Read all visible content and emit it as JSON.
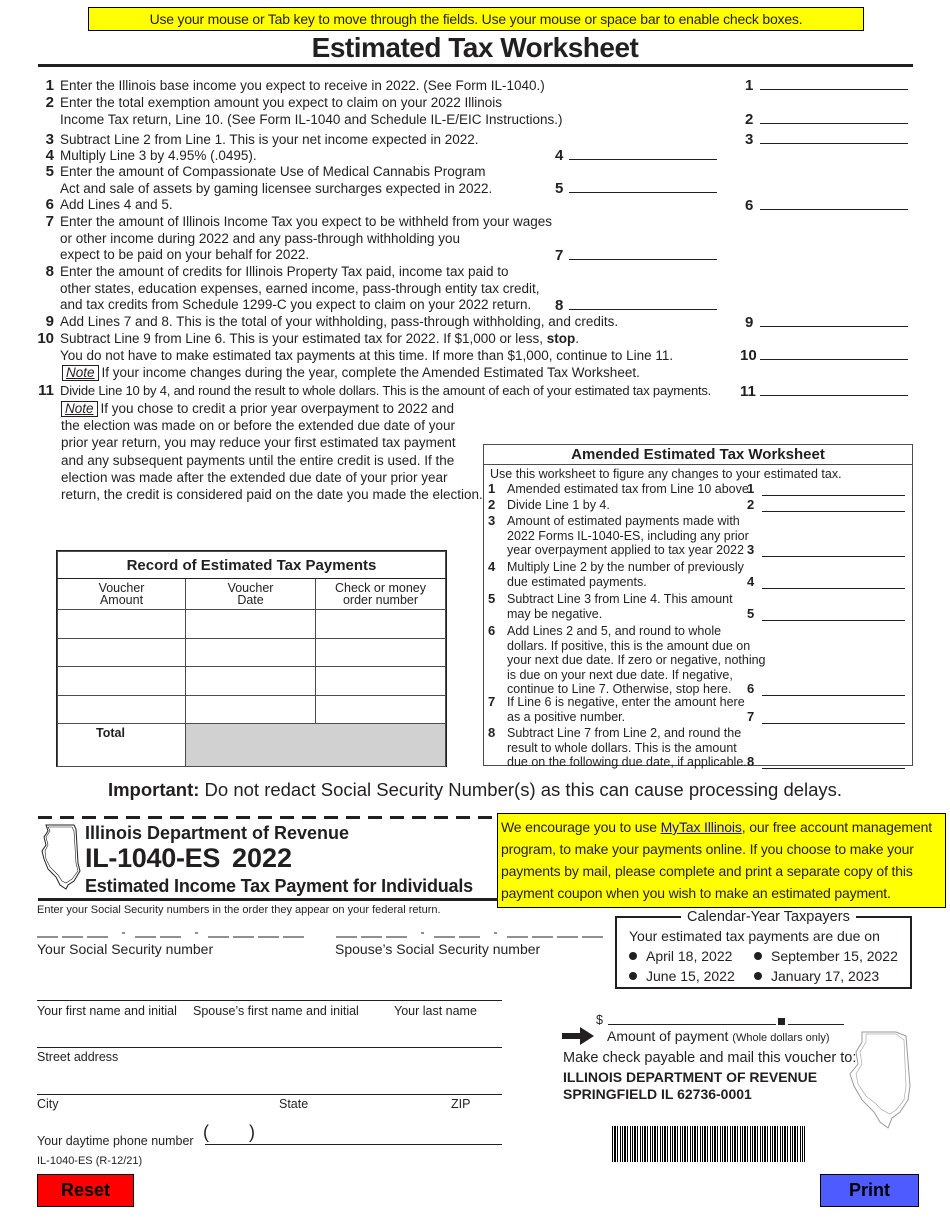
{
  "banner": "Use your mouse or Tab key to move through the fields. Use your mouse or space bar to enable check boxes.",
  "worksheet": {
    "title": "Estimated Tax Worksheet",
    "lines": [
      {
        "num": "1",
        "text": [
          "Enter the Illinois base income you expect to receive in 2022. (See Form IL-1040.)"
        ],
        "field_label": "1"
      },
      {
        "num": "2",
        "text": [
          "Enter the total exemption amount you expect to claim on your 2022 Illinois",
          "Income Tax return, Line 10.  (See Form IL-1040 and Schedule IL-E/EIC Instructions.)"
        ],
        "field_label": "2"
      },
      {
        "num": "3",
        "text": [
          "Subtract Line 2 from Line 1. This is your net income expected in 2022."
        ],
        "field_label": "3"
      },
      {
        "num": "4",
        "text": [
          "Multiply Line 3 by 4.95% (.0495)."
        ],
        "field_label": "4"
      },
      {
        "num": "5",
        "text": [
          "Enter the amount of Compassionate Use of Medical Cannabis Program",
          "Act and sale of assets by gaming licensee surcharges expected in 2022."
        ],
        "field_label": "5"
      },
      {
        "num": "6",
        "text": [
          "Add Lines 4 and 5."
        ],
        "field_label": "6"
      },
      {
        "num": "7",
        "text": [
          "Enter the amount of Illinois Income Tax you expect to be withheld from your wages",
          "or other income during 2022 and any pass-through withholding you",
          "expect to be paid on your behalf for 2022."
        ],
        "field_label": "7"
      },
      {
        "num": "8",
        "text": [
          "Enter the amount of credits for Illinois Property Tax paid, income tax paid to",
          "other states, education expenses, earned income, pass-through entity tax credit,",
          "and tax credits from Schedule 1299-C you expect to claim on your 2022 return."
        ],
        "field_label": "8"
      },
      {
        "num": "9",
        "text": [
          "Add Lines 7 and 8. This is the total of your withholding, pass-through withholding, and credits."
        ],
        "field_label": "9"
      },
      {
        "num": "10",
        "text": [
          "Subtract Line 9 from Line 6. This is your estimated tax for 2022. If $1,000 or less, ",
          "You do not have to make estimated tax payments at this time. If more than $1,000, continue to Line 11."
        ],
        "stop_word": "stop",
        "field_label": "10"
      },
      {
        "num": "11",
        "text": [
          "Divide Line 10 by 4, and round the result to whole dollars. This is the amount of each of your estimated tax payments."
        ],
        "field_label": "11"
      }
    ],
    "note_label": "Note",
    "note10": "If your income changes during the year, complete the Amended Estimated Tax Worksheet.",
    "note11": [
      "If you chose to credit a prior year overpayment to 2022 and",
      "the election was made on or before the extended due date of your",
      "prior year return, you may reduce your first estimated tax payment",
      "and any subsequent payments until the entire credit is used. If the",
      "election was made after the extended due date of your prior year",
      "return, the credit is considered paid on the date you made the election."
    ]
  },
  "amended": {
    "title": "Amended Estimated Tax Worksheet",
    "intro": "Use this worksheet to figure any changes to your estimated tax.",
    "lines": [
      {
        "num": "1",
        "text": [
          "Amended estimated tax from Line 10 above"
        ]
      },
      {
        "num": "2",
        "text": [
          "Divide Line 1 by 4."
        ]
      },
      {
        "num": "3",
        "text": [
          "Amount of estimated payments made with",
          "2022 Forms IL-1040-ES, including any prior",
          "year overpayment applied to tax year 2022"
        ]
      },
      {
        "num": "4",
        "text": [
          "Multiply Line 2 by the number of previously",
          "due estimated payments."
        ]
      },
      {
        "num": "5",
        "text": [
          "Subtract Line 3 from Line 4. This amount",
          "may be negative."
        ]
      },
      {
        "num": "6",
        "text": [
          "Add Lines 2 and 5, and round to whole",
          "dollars. If positive, this is the amount due on",
          "your next due date. If zero or negative, nothing",
          "is due on your next due date. If negative,",
          "continue to Line 7. Otherwise, stop here."
        ]
      },
      {
        "num": "7",
        "text": [
          "If Line 6 is negative, enter the amount here",
          "as a positive number."
        ]
      },
      {
        "num": "8",
        "text": [
          "Subtract Line 7 from Line 2, and round the",
          "result to whole dollars. This is the amount",
          "due on the following due date, if applicable."
        ]
      }
    ]
  },
  "record": {
    "title": "Record of Estimated Tax Payments",
    "columns": [
      [
        "Voucher",
        "Amount"
      ],
      [
        "Voucher",
        "Date"
      ],
      [
        "Check or money",
        "order number"
      ]
    ],
    "rows": [
      [
        "",
        "",
        ""
      ],
      [
        "",
        "",
        ""
      ],
      [
        "",
        "",
        ""
      ],
      [
        "",
        "",
        ""
      ]
    ],
    "total_label": "Total"
  },
  "important": {
    "label": "Important:",
    "text": " Do not redact Social Security Number(s) as this can cause processing delays."
  },
  "notice": {
    "before": "We encourage you to use ",
    "link": "MyTax Illinois",
    "after": ", our free account management program, to make your payments online. If you choose to make your payments by mail, please complete and print a separate copy of this payment coupon when you wish to make an estimated payment."
  },
  "voucher": {
    "agency": "Illinois Department of Revenue",
    "form_id": "IL-1040-ES",
    "year": "2022",
    "subtitle": "Estimated Income Tax Payment for Individuals",
    "ssn_instruction": "Enter your Social Security numbers in the order they appear on your federal return.",
    "ssn_label": "Your Social Security number",
    "spouse_ssn_label": "Spouse’s Social Security number",
    "first_name_label": "Your first name and initial",
    "spouse_name_label": "Spouse’s first name and initial",
    "last_name_label": "Your last name",
    "street_label": "Street address",
    "city_label": "City",
    "state_label": "State",
    "zip_label": "ZIP",
    "phone_label": "Your daytime phone number",
    "phone_open": "(",
    "phone_close": ")",
    "revision": "IL-1040-ES (R-12/21)",
    "calendar": {
      "title": "Calendar-Year Taxpayers",
      "intro": "Your estimated tax payments are due on",
      "dates": [
        "April 18, 2022",
        "September 15,  2022",
        "June 15,  2022",
        "January 17, 2023"
      ]
    },
    "dollar_sign": "$",
    "amount_label": "Amount of payment",
    "amount_note": "(Whole dollars only)",
    "mail_to": "Make check payable and mail this voucher to:",
    "address1": "ILLINOIS DEPARTMENT OF REVENUE",
    "address2": "SPRINGFIELD IL 62736-0001"
  },
  "buttons": {
    "reset": "Reset",
    "print": "Print"
  },
  "colors": {
    "banner_bg": "#ffff00",
    "reset_bg": "#ff0000",
    "print_bg": "#4d5bff",
    "link": "#1a0dab"
  }
}
